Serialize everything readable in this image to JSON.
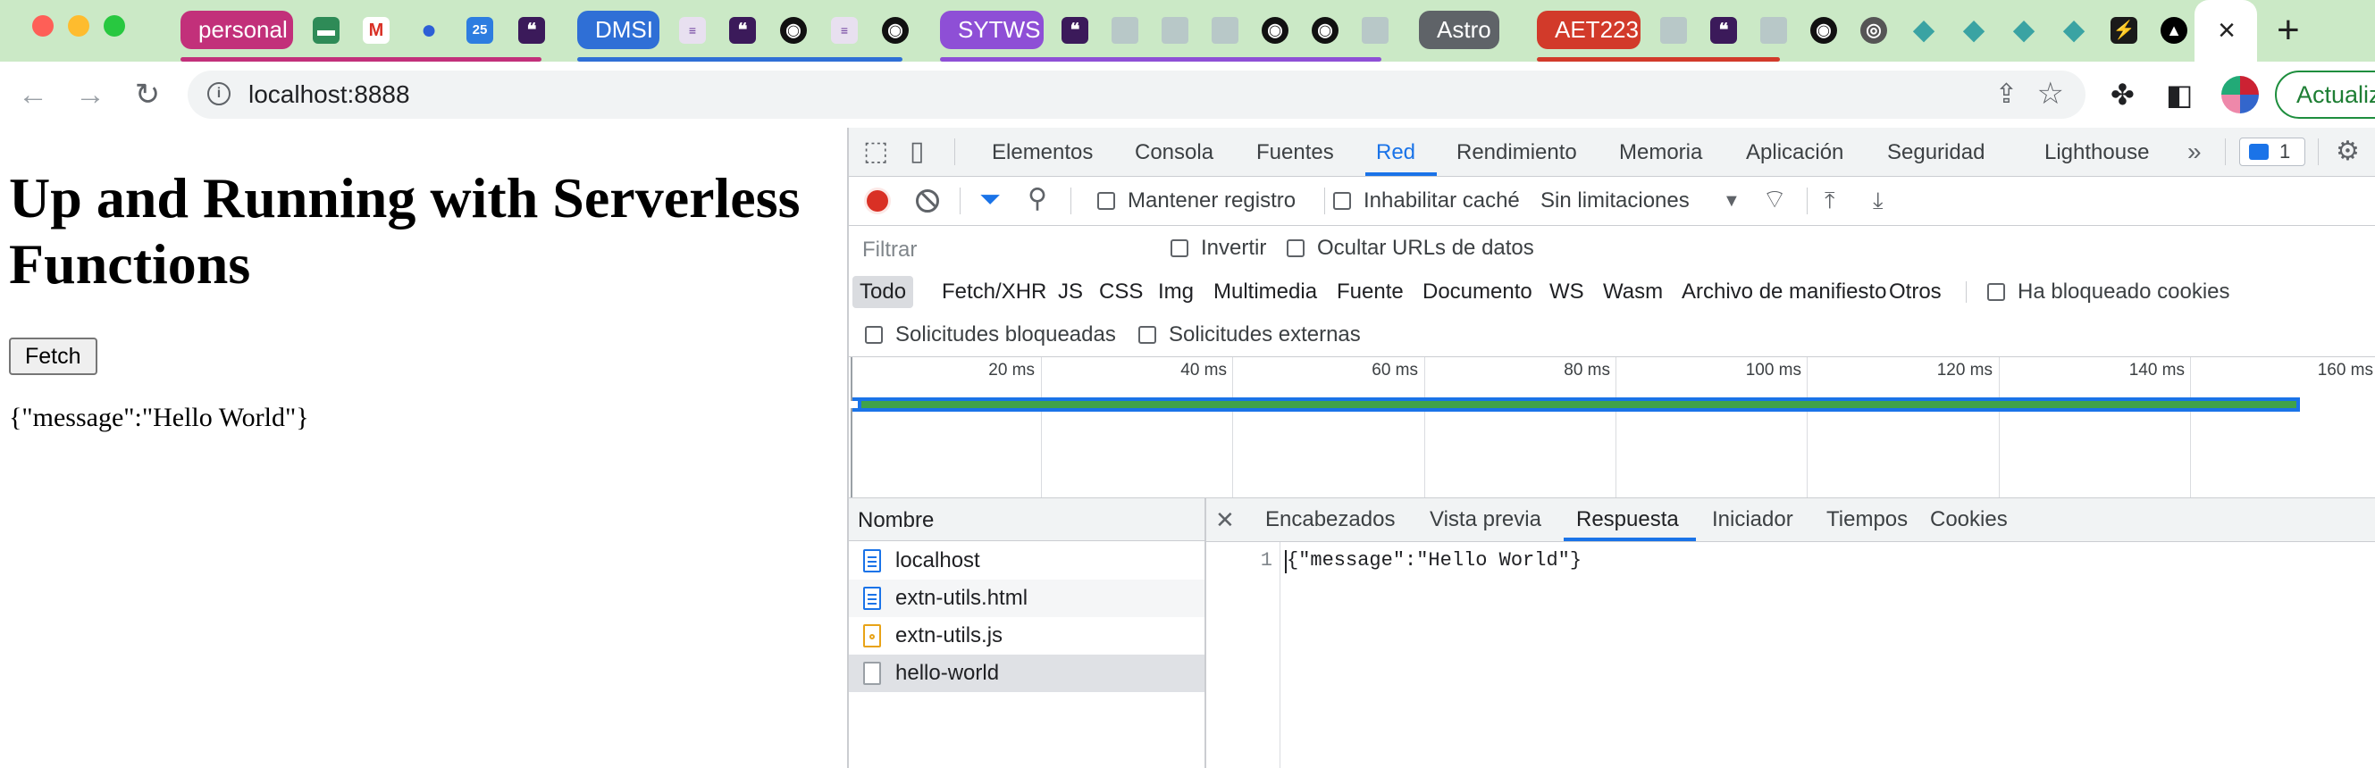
{
  "tabs": {
    "groups": [
      {
        "label": "personal",
        "color": "#c2307a"
      },
      {
        "label": "DMSI",
        "color": "#2f6fd6"
      },
      {
        "label": "SYTWS",
        "color": "#8e4fd6"
      },
      {
        "label": "Astro",
        "color": "#5f6368"
      },
      {
        "label": "AET223",
        "color": "#d23a2a"
      }
    ],
    "close_glyph": "×",
    "new_tab_glyph": "+"
  },
  "address": {
    "url": "localhost:8888",
    "update_label": "Actualiz"
  },
  "page": {
    "title": "Up and Running with Serverless Functions",
    "fetch_button": "Fetch",
    "result": "{\"message\":\"Hello World\"}"
  },
  "devtools": {
    "panels": [
      "Elementos",
      "Consola",
      "Fuentes",
      "Red",
      "Rendimiento",
      "Memoria",
      "Aplicación",
      "Seguridad",
      "Lighthouse"
    ],
    "selected_panel": "Red",
    "issues_count": "1",
    "toolbar": {
      "preserve_log": "Mantener registro",
      "disable_cache": "Inhabilitar caché",
      "throttling": "Sin limitaciones"
    },
    "filter": {
      "placeholder": "Filtrar",
      "invert": "Invertir",
      "hide_data_urls": "Ocultar URLs de datos",
      "types": [
        "Todo",
        "Fetch/XHR",
        "JS",
        "CSS",
        "Img",
        "Multimedia",
        "Fuente",
        "Documento",
        "WS",
        "Wasm",
        "Archivo de manifiesto",
        "Otros"
      ],
      "selected_type": "Todo",
      "blocked_cookies": "Ha bloqueado cookies",
      "blocked_requests": "Solicitudes bloqueadas",
      "third_party": "Solicitudes externas"
    },
    "timeline_ticks": [
      "20 ms",
      "40 ms",
      "60 ms",
      "80 ms",
      "100 ms",
      "120 ms",
      "140 ms",
      "160 ms"
    ],
    "requests_header": "Nombre",
    "requests": [
      {
        "name": "localhost",
        "type": "document"
      },
      {
        "name": "extn-utils.html",
        "type": "document"
      },
      {
        "name": "extn-utils.js",
        "type": "script"
      },
      {
        "name": "hello-world",
        "type": "fetch"
      }
    ],
    "selected_request": "hello-world",
    "detail_tabs": [
      "Encabezados",
      "Vista previa",
      "Respuesta",
      "Iniciador",
      "Tiempos",
      "Cookies"
    ],
    "selected_detail_tab": "Respuesta",
    "response": {
      "line_number": "1",
      "body": "{\"message\":\"Hello World\"}"
    }
  }
}
